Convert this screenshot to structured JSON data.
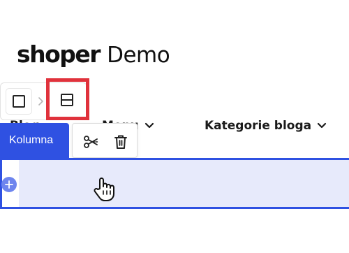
{
  "logo": {
    "bold": "shoper",
    "light": "Demo"
  },
  "nav": {
    "blog_label": "Blog",
    "menu_label": "Menu",
    "categories_label": "Kategorie bloga"
  },
  "toolbar": {
    "column_label": "Kolumna"
  },
  "icons": {
    "breadcrumb_column": "square-icon",
    "breadcrumb_separator": "chevron-right-icon",
    "breadcrumb_row": "row-split-icon",
    "cut": "scissors-icon",
    "delete": "trash-icon",
    "add": "plus-icon",
    "cursor": "hand-pointer-icon"
  },
  "colors": {
    "accent": "#2f51e2",
    "highlight": "#e0323c",
    "selection_fill": "#e7eafb"
  }
}
